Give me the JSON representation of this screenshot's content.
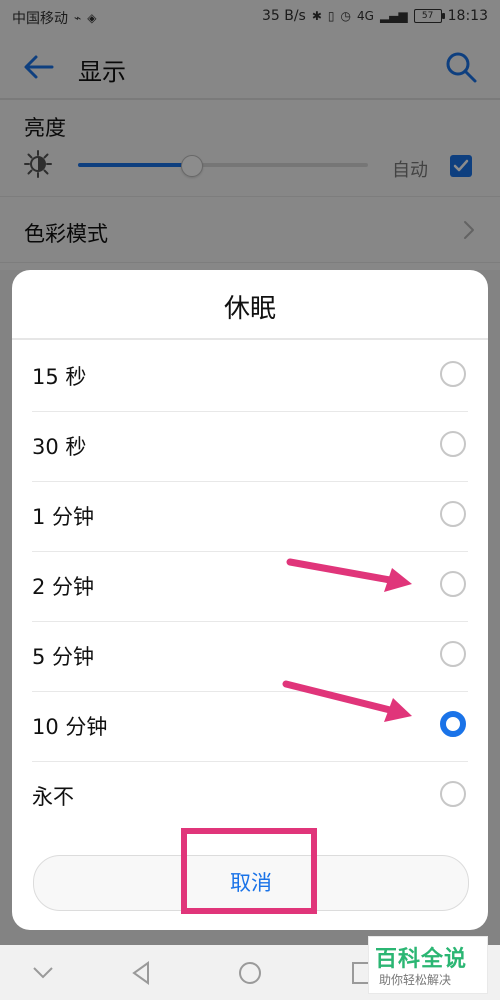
{
  "status": {
    "carrier": "中国移动",
    "speed": "35 B/s",
    "network_badge": "4G",
    "battery": "57",
    "time": "18:13"
  },
  "appbar": {
    "title": "显示",
    "back_icon": "back-arrow-icon",
    "search_icon": "search-icon"
  },
  "settings": {
    "brightness_label": "亮度",
    "brightness_level": 0.39,
    "auto_label": "自动",
    "auto_checked": true,
    "color_mode_label": "色彩模式"
  },
  "dialog": {
    "title": "休眠",
    "options": [
      {
        "label": "15 秒",
        "selected": false
      },
      {
        "label": "30 秒",
        "selected": false
      },
      {
        "label": "1 分钟",
        "selected": false
      },
      {
        "label": "2 分钟",
        "selected": false
      },
      {
        "label": "5 分钟",
        "selected": false
      },
      {
        "label": "10 分钟",
        "selected": true
      },
      {
        "label": "永不",
        "selected": false
      }
    ],
    "cancel_label": "取消"
  },
  "watermark": {
    "title": "百科全说",
    "subtitle": "助你轻松解决"
  },
  "colors": {
    "accent": "#1a73e8",
    "annotation": "#e0357a"
  }
}
